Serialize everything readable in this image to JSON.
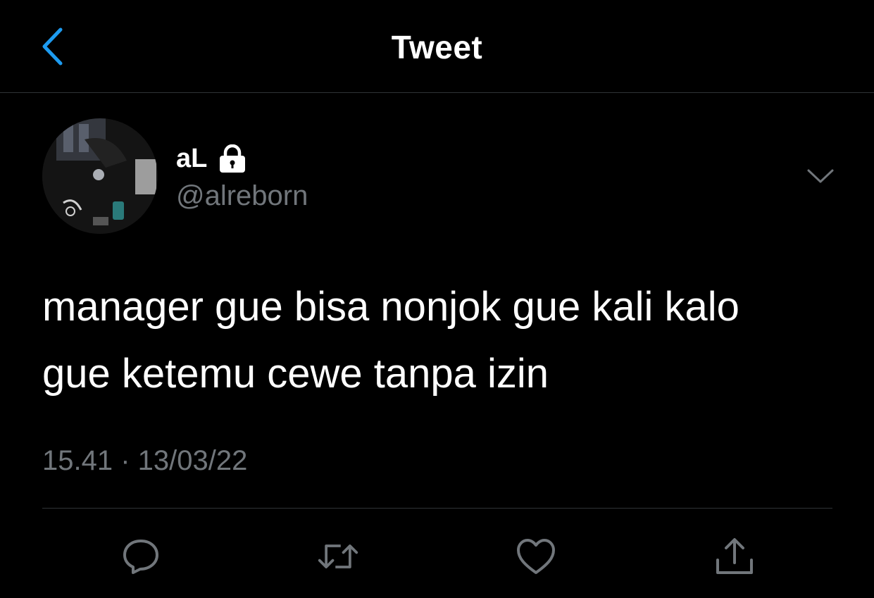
{
  "header": {
    "title": "Tweet",
    "back_icon": "chevron-left-icon",
    "accent_color": "#1d9bf0"
  },
  "author": {
    "display_name": "aL",
    "handle": "@alreborn",
    "protected_icon": "lock-icon",
    "avatar": "avatar-photo"
  },
  "tweet": {
    "text_lines": [
      "manager gue bisa nonjok gue kali kalo",
      "gue ketemu cewe tanpa izin"
    ],
    "timestamp": "15.41 · 13/03/22"
  },
  "actions": [
    {
      "name": "reply",
      "icon": "reply-icon"
    },
    {
      "name": "retweet",
      "icon": "retweet-icon"
    },
    {
      "name": "like",
      "icon": "heart-icon"
    },
    {
      "name": "share",
      "icon": "share-icon"
    }
  ],
  "colors": {
    "background": "#000000",
    "text": "#ffffff",
    "secondary_text": "#71767b",
    "divider": "#2f3336"
  }
}
